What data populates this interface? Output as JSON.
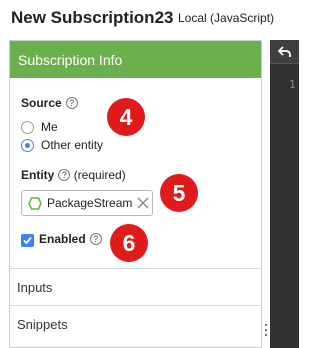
{
  "title": {
    "name": "New Subscription23",
    "context": "Local (JavaScript)"
  },
  "panel": {
    "header": "Subscription Info",
    "source": {
      "label": "Source",
      "help_icon": "question-circle-icon",
      "options": [
        {
          "label": "Me",
          "checked": false
        },
        {
          "label": "Other entity",
          "checked": true
        }
      ]
    },
    "entity": {
      "label": "Entity",
      "required_text": "(required)",
      "value": "PackageStream",
      "value_icon": "hexagon-icon",
      "clear_icon": "close-icon"
    },
    "enabled": {
      "label": "Enabled",
      "checked": true
    },
    "sections": [
      "Inputs",
      "Snippets"
    ]
  },
  "badges": [
    "4",
    "5",
    "6"
  ],
  "editor": {
    "toolbar_icon": "undo-icon",
    "line_numbers": [
      "1"
    ]
  },
  "colors": {
    "header_green": "#6ab04c",
    "badge_red": "#e01b1b",
    "accent_blue": "#3b82f6",
    "editor_dark": "#2b2b2b"
  }
}
